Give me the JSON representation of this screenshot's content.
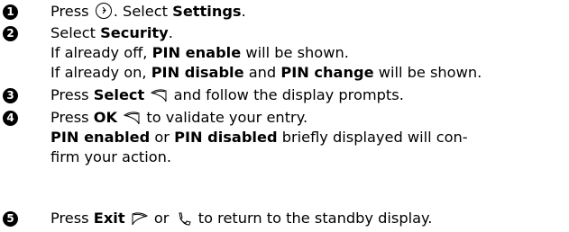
{
  "steps": [
    {
      "number": "1",
      "lines": [
        {
          "press": "Press",
          "after_icon": ". Select",
          "bold": "Settings",
          "end": "."
        }
      ]
    },
    {
      "number": "2",
      "lines": [
        {
          "select": "Select",
          "bold": "Security",
          "end": "."
        },
        {
          "prefix": "If already off,",
          "bold": "PIN enable",
          "suffix": "will be shown."
        },
        {
          "prefix": "If already on,",
          "bold1": "PIN disable",
          "and": "and",
          "bold2": "PIN change",
          "suffix": "will be shown."
        }
      ]
    },
    {
      "number": "3",
      "lines": [
        {
          "press": "Press",
          "bold": "Select",
          "suffix": "and follow the display prompts."
        }
      ]
    },
    {
      "number": "4",
      "lines": [
        {
          "press": "Press",
          "bold": "OK",
          "suffix": "to validate your entry."
        },
        {
          "bold1": "PIN enabled",
          "or": "or",
          "bold2": "PIN disabled",
          "suffix": "briefly displayed will con-"
        },
        {
          "text": "firm your action."
        }
      ]
    },
    {
      "number": "5",
      "lines": [
        {
          "press": "Press",
          "bold": "Exit",
          "or": "or",
          "suffix": "to return to the standby display."
        }
      ]
    }
  ],
  "icons": {
    "menu_key": "menu-key-icon",
    "right_softkey": "right-softkey-icon",
    "left_softkey": "left-softkey-icon",
    "end_call_key": "end-call-key-icon"
  }
}
